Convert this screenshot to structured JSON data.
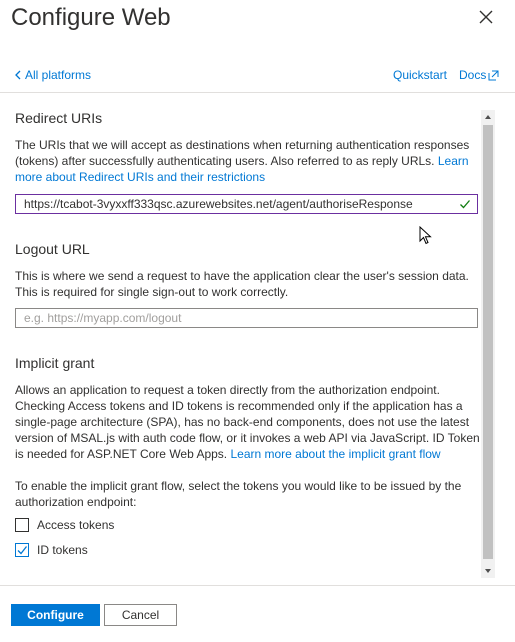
{
  "panel": {
    "title": "Configure Web",
    "back_label": "All platforms",
    "quickstart_label": "Quickstart",
    "docs_label": "Docs"
  },
  "redirect": {
    "heading": "Redirect URIs",
    "description": "The URIs that we will accept as destinations when returning authentication responses (tokens) after successfully authenticating users. Also referred to as reply URLs.",
    "link": "Learn more about Redirect URIs and their restrictions",
    "value": "https://tcabot-3vyxxff333qsc.azurewebsites.net/agent/authoriseResponse"
  },
  "logout": {
    "heading": "Logout URL",
    "description": "This is where we send a request to have the application clear the user's session data. This is required for single sign-out to work correctly.",
    "placeholder": "e.g. https://myapp.com/logout"
  },
  "implicit": {
    "heading": "Implicit grant",
    "description": "Allows an application to request a token directly from the authorization endpoint. Checking Access tokens and ID tokens is recommended only if the application has a single-page architecture (SPA), has no back-end components, does not use the latest version of MSAL.js with auth code flow, or it invokes a web API via JavaScript. ID Token is needed for ASP.NET Core Web Apps.",
    "link": "Learn more about the implicit grant flow",
    "instruction": "To enable the implicit grant flow, select the tokens you would like to be issued by the authorization endpoint:",
    "options": [
      {
        "label": "Access tokens",
        "checked": false
      },
      {
        "label": "ID tokens",
        "checked": true
      }
    ]
  },
  "footer": {
    "configure_label": "Configure",
    "cancel_label": "Cancel"
  },
  "colors": {
    "accent": "#0078d4",
    "valid": "#107c10",
    "focus_border": "#6b2fa0"
  },
  "icons": [
    "close-icon",
    "chevron-left-icon",
    "external-link-icon",
    "check-icon",
    "checkbox-check-icon",
    "mouse-cursor-icon"
  ]
}
